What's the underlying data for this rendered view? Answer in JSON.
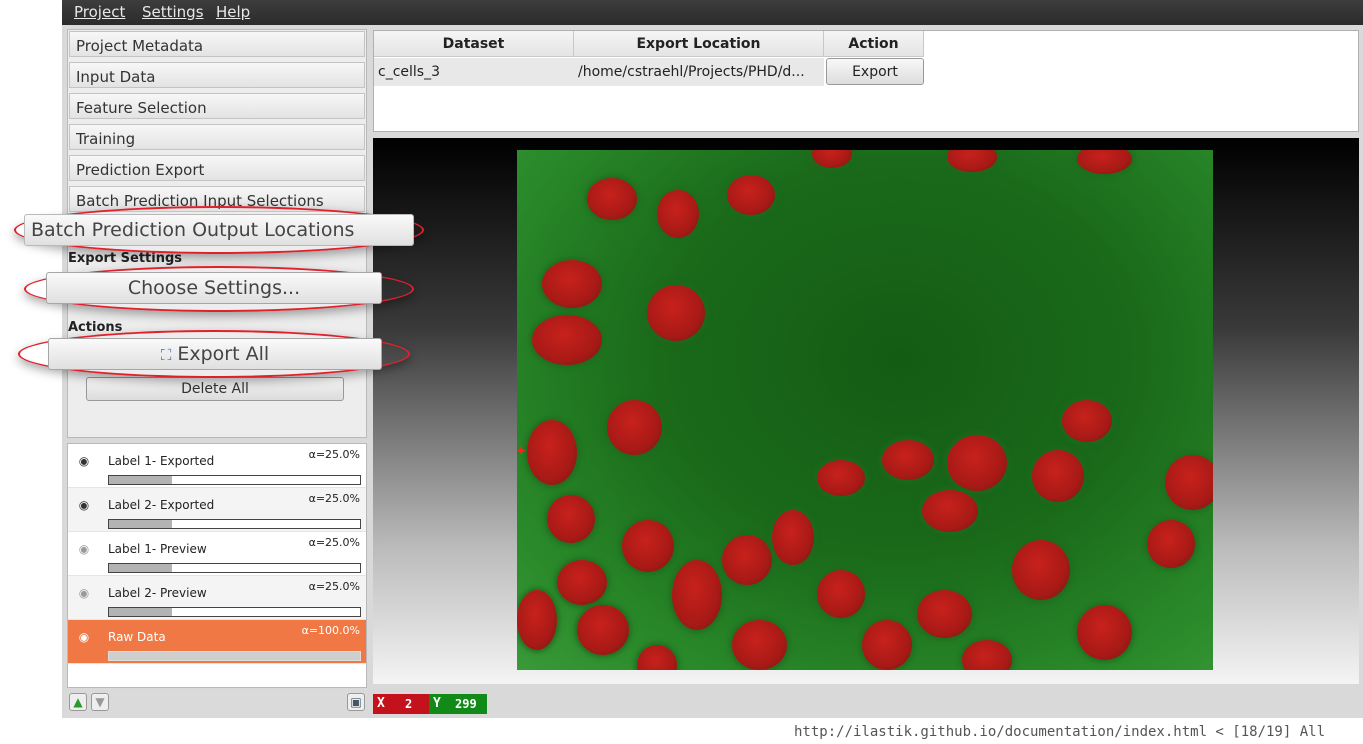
{
  "menubar": {
    "items": [
      "Project",
      "Settings",
      "Help"
    ]
  },
  "drawer": {
    "items": [
      "Project Metadata",
      "Input Data",
      "Feature Selection",
      "Training",
      "Prediction Export",
      "Batch Prediction Input Selections",
      "Batch Prediction Output Locations"
    ],
    "export_settings_label": "Export Settings",
    "choose_settings_label": "Choose Settings...",
    "actions_label": "Actions",
    "export_all_label": "Export All",
    "delete_all_label": "Delete All"
  },
  "layers": [
    {
      "name": "Label 1- Exported",
      "alpha": "α=25.0%",
      "opacity": 0.25,
      "visible_icon": "eye-icon"
    },
    {
      "name": "Label 2- Exported",
      "alpha": "α=25.0%",
      "opacity": 0.25,
      "visible_icon": "eye-icon"
    },
    {
      "name": "Label 1- Preview",
      "alpha": "α=25.0%",
      "opacity": 0.25,
      "visible_icon": "eye-icon"
    },
    {
      "name": "Label 2- Preview",
      "alpha": "α=25.0%",
      "opacity": 0.25,
      "visible_icon": "eye-icon"
    },
    {
      "name": "Raw Data",
      "alpha": "α=100.0%",
      "opacity": 1.0,
      "visible_icon": "eye-icon"
    }
  ],
  "table": {
    "headers": [
      "Dataset",
      "Export Location",
      "Action"
    ],
    "rows": [
      {
        "dataset": "c_cells_3",
        "location": "/home/cstraehl/Projects/PHD/d...",
        "action": "Export"
      }
    ]
  },
  "coords": {
    "x_label": "X",
    "x_value": "2",
    "y_label": "Y",
    "y_value": "299"
  },
  "statusline": "http://ilastik.github.io/documentation/index.html < [18/19] All",
  "colors": {
    "callout": "#e0212c",
    "selected_layer": "#f07844",
    "coord_x": "#c3121b",
    "coord_y": "#118a18"
  }
}
